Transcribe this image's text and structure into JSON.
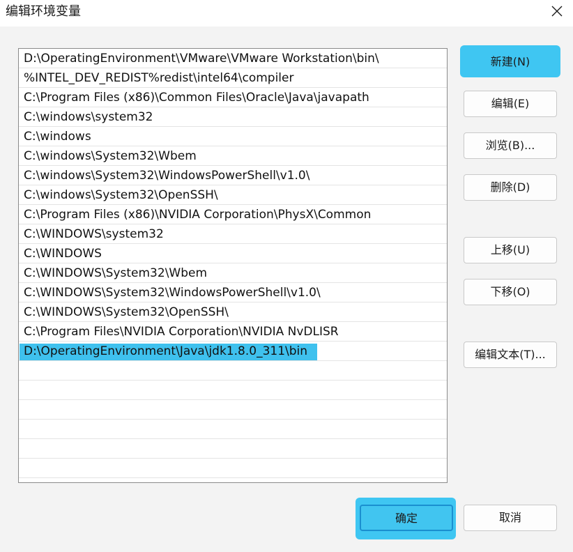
{
  "window": {
    "title": "编辑环境变量",
    "close_icon": "close-icon"
  },
  "list": {
    "items": [
      "D:\\OperatingEnvironment\\VMware\\VMware Workstation\\bin\\",
      "%INTEL_DEV_REDIST%redist\\intel64\\compiler",
      "C:\\Program Files (x86)\\Common Files\\Oracle\\Java\\javapath",
      "C:\\windows\\system32",
      "C:\\windows",
      "C:\\windows\\System32\\Wbem",
      "C:\\windows\\System32\\WindowsPowerShell\\v1.0\\",
      "C:\\windows\\System32\\OpenSSH\\",
      "C:\\Program Files (x86)\\NVIDIA Corporation\\PhysX\\Common",
      "C:\\WINDOWS\\system32",
      "C:\\WINDOWS",
      "C:\\WINDOWS\\System32\\Wbem",
      "C:\\WINDOWS\\System32\\WindowsPowerShell\\v1.0\\",
      "C:\\WINDOWS\\System32\\OpenSSH\\",
      "C:\\Program Files\\NVIDIA Corporation\\NVIDIA NvDLISR",
      "D:\\OperatingEnvironment\\Java\\jdk1.8.0_311\\bin"
    ],
    "selected_index": 15,
    "empty_rows": 6
  },
  "buttons": {
    "new": "新建(N)",
    "edit": "编辑(E)",
    "browse": "浏览(B)...",
    "delete": "删除(D)",
    "move_up": "上移(U)",
    "move_down": "下移(O)",
    "edit_text": "编辑文本(T)...",
    "ok": "确定",
    "cancel": "取消"
  },
  "colors": {
    "highlight": "#3fc6f2",
    "background": "#f3f3f3"
  }
}
